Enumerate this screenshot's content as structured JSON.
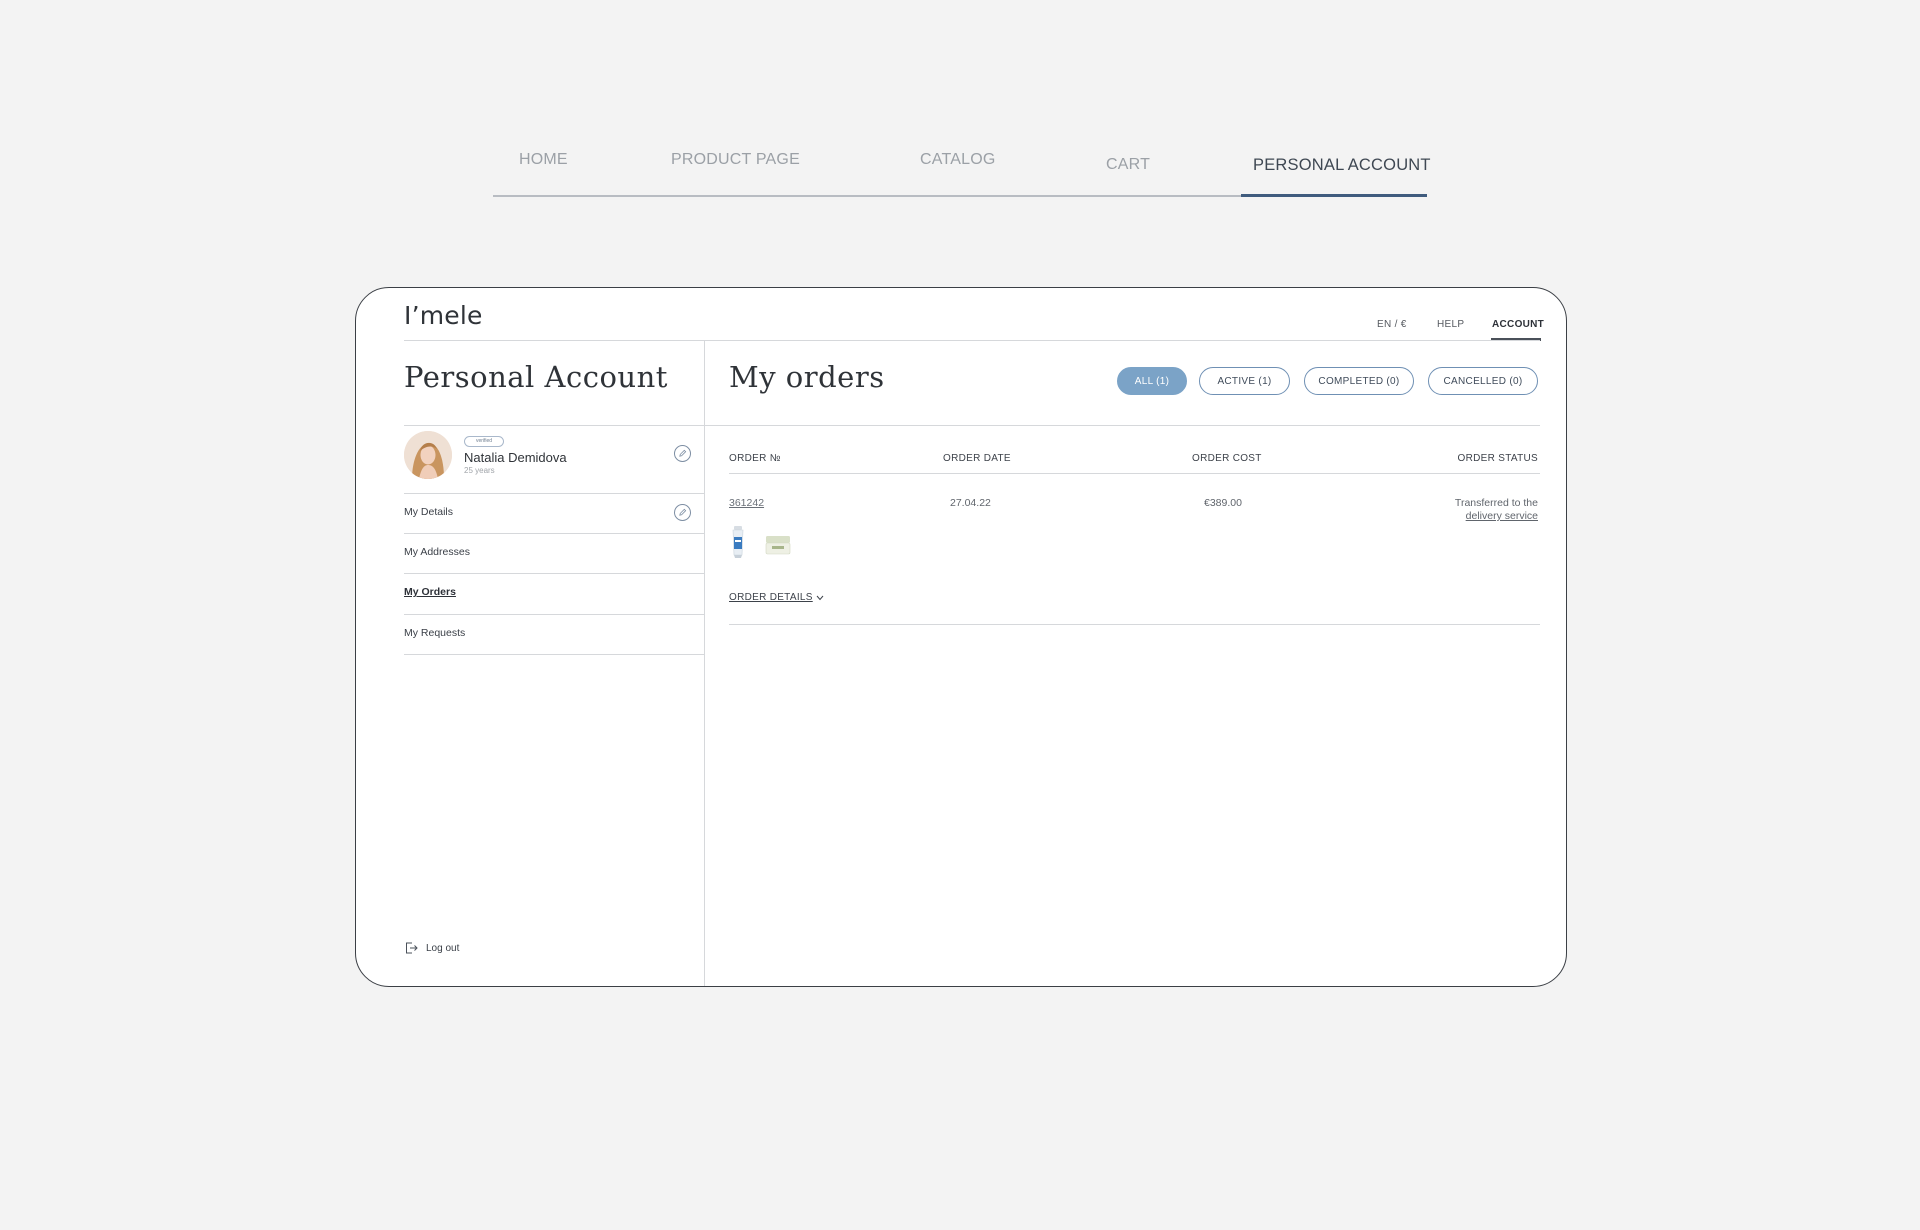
{
  "showcase_nav": {
    "tabs": [
      {
        "label": "HOME",
        "active": false
      },
      {
        "label": "PRODUCT PAGE",
        "active": false
      },
      {
        "label": "CATALOG",
        "active": false
      },
      {
        "label": "CART",
        "active": false
      },
      {
        "label": "PERSONAL ACCOUNT",
        "active": true
      }
    ]
  },
  "header": {
    "logo": "I’mele",
    "language_currency": "EN / €",
    "help": "HELP",
    "account": "ACCOUNT"
  },
  "sidebar": {
    "title": "Personal Account",
    "user": {
      "badge": "verified",
      "name": "Natalia Demidova",
      "age": "25 years"
    },
    "items": [
      {
        "label": "My Details",
        "active": false
      },
      {
        "label": "My Addresses",
        "active": false
      },
      {
        "label": "My Orders",
        "active": true
      },
      {
        "label": "My Requests",
        "active": false
      }
    ],
    "logout": "Log out"
  },
  "main": {
    "title": "My orders",
    "filters": [
      {
        "label": "ALL (1)",
        "active": true
      },
      {
        "label": "ACTIVE (1)",
        "active": false
      },
      {
        "label": "COMPLETED (0)",
        "active": false
      },
      {
        "label": "CANCELLED (0)",
        "active": false
      }
    ],
    "columns": [
      "ORDER №",
      "ORDER DATE",
      "ORDER COST",
      "ORDER STATUS"
    ],
    "orders": [
      {
        "number": "361242",
        "date": "27.04.22",
        "cost": "€389.00",
        "status_text": "Transferred to the",
        "status_link": "delivery service",
        "details_label": "ORDER DETAILS"
      }
    ]
  },
  "colors": {
    "background": "#f3f3f3",
    "accent": "#7ba3c7",
    "nav_active": "#3f5b7d"
  }
}
